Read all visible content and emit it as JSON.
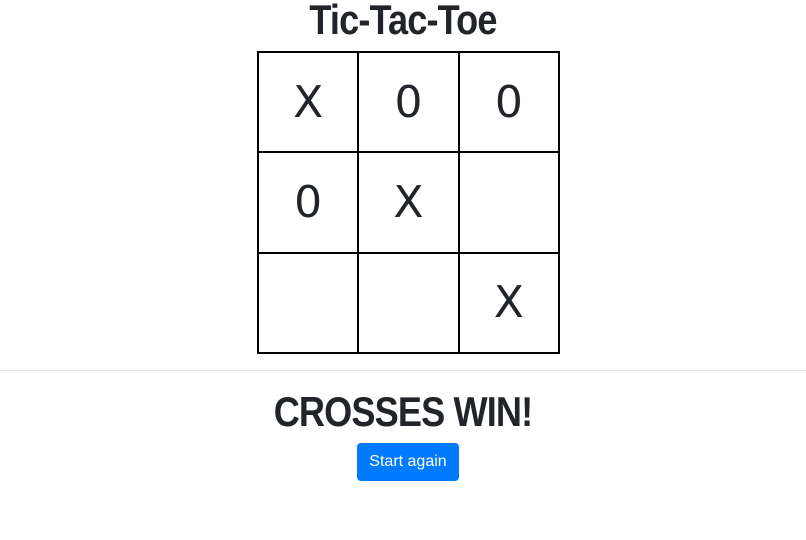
{
  "game": {
    "title": "Tic-Tac-Toe",
    "board": [
      [
        "X",
        "0",
        "0"
      ],
      [
        "0",
        "X",
        ""
      ],
      [
        "",
        "",
        "X"
      ]
    ],
    "result": "CROSSES WIN!",
    "restart_label": "Start again"
  },
  "colors": {
    "button": "#007bff",
    "text": "#212529",
    "grid": "#000000"
  }
}
